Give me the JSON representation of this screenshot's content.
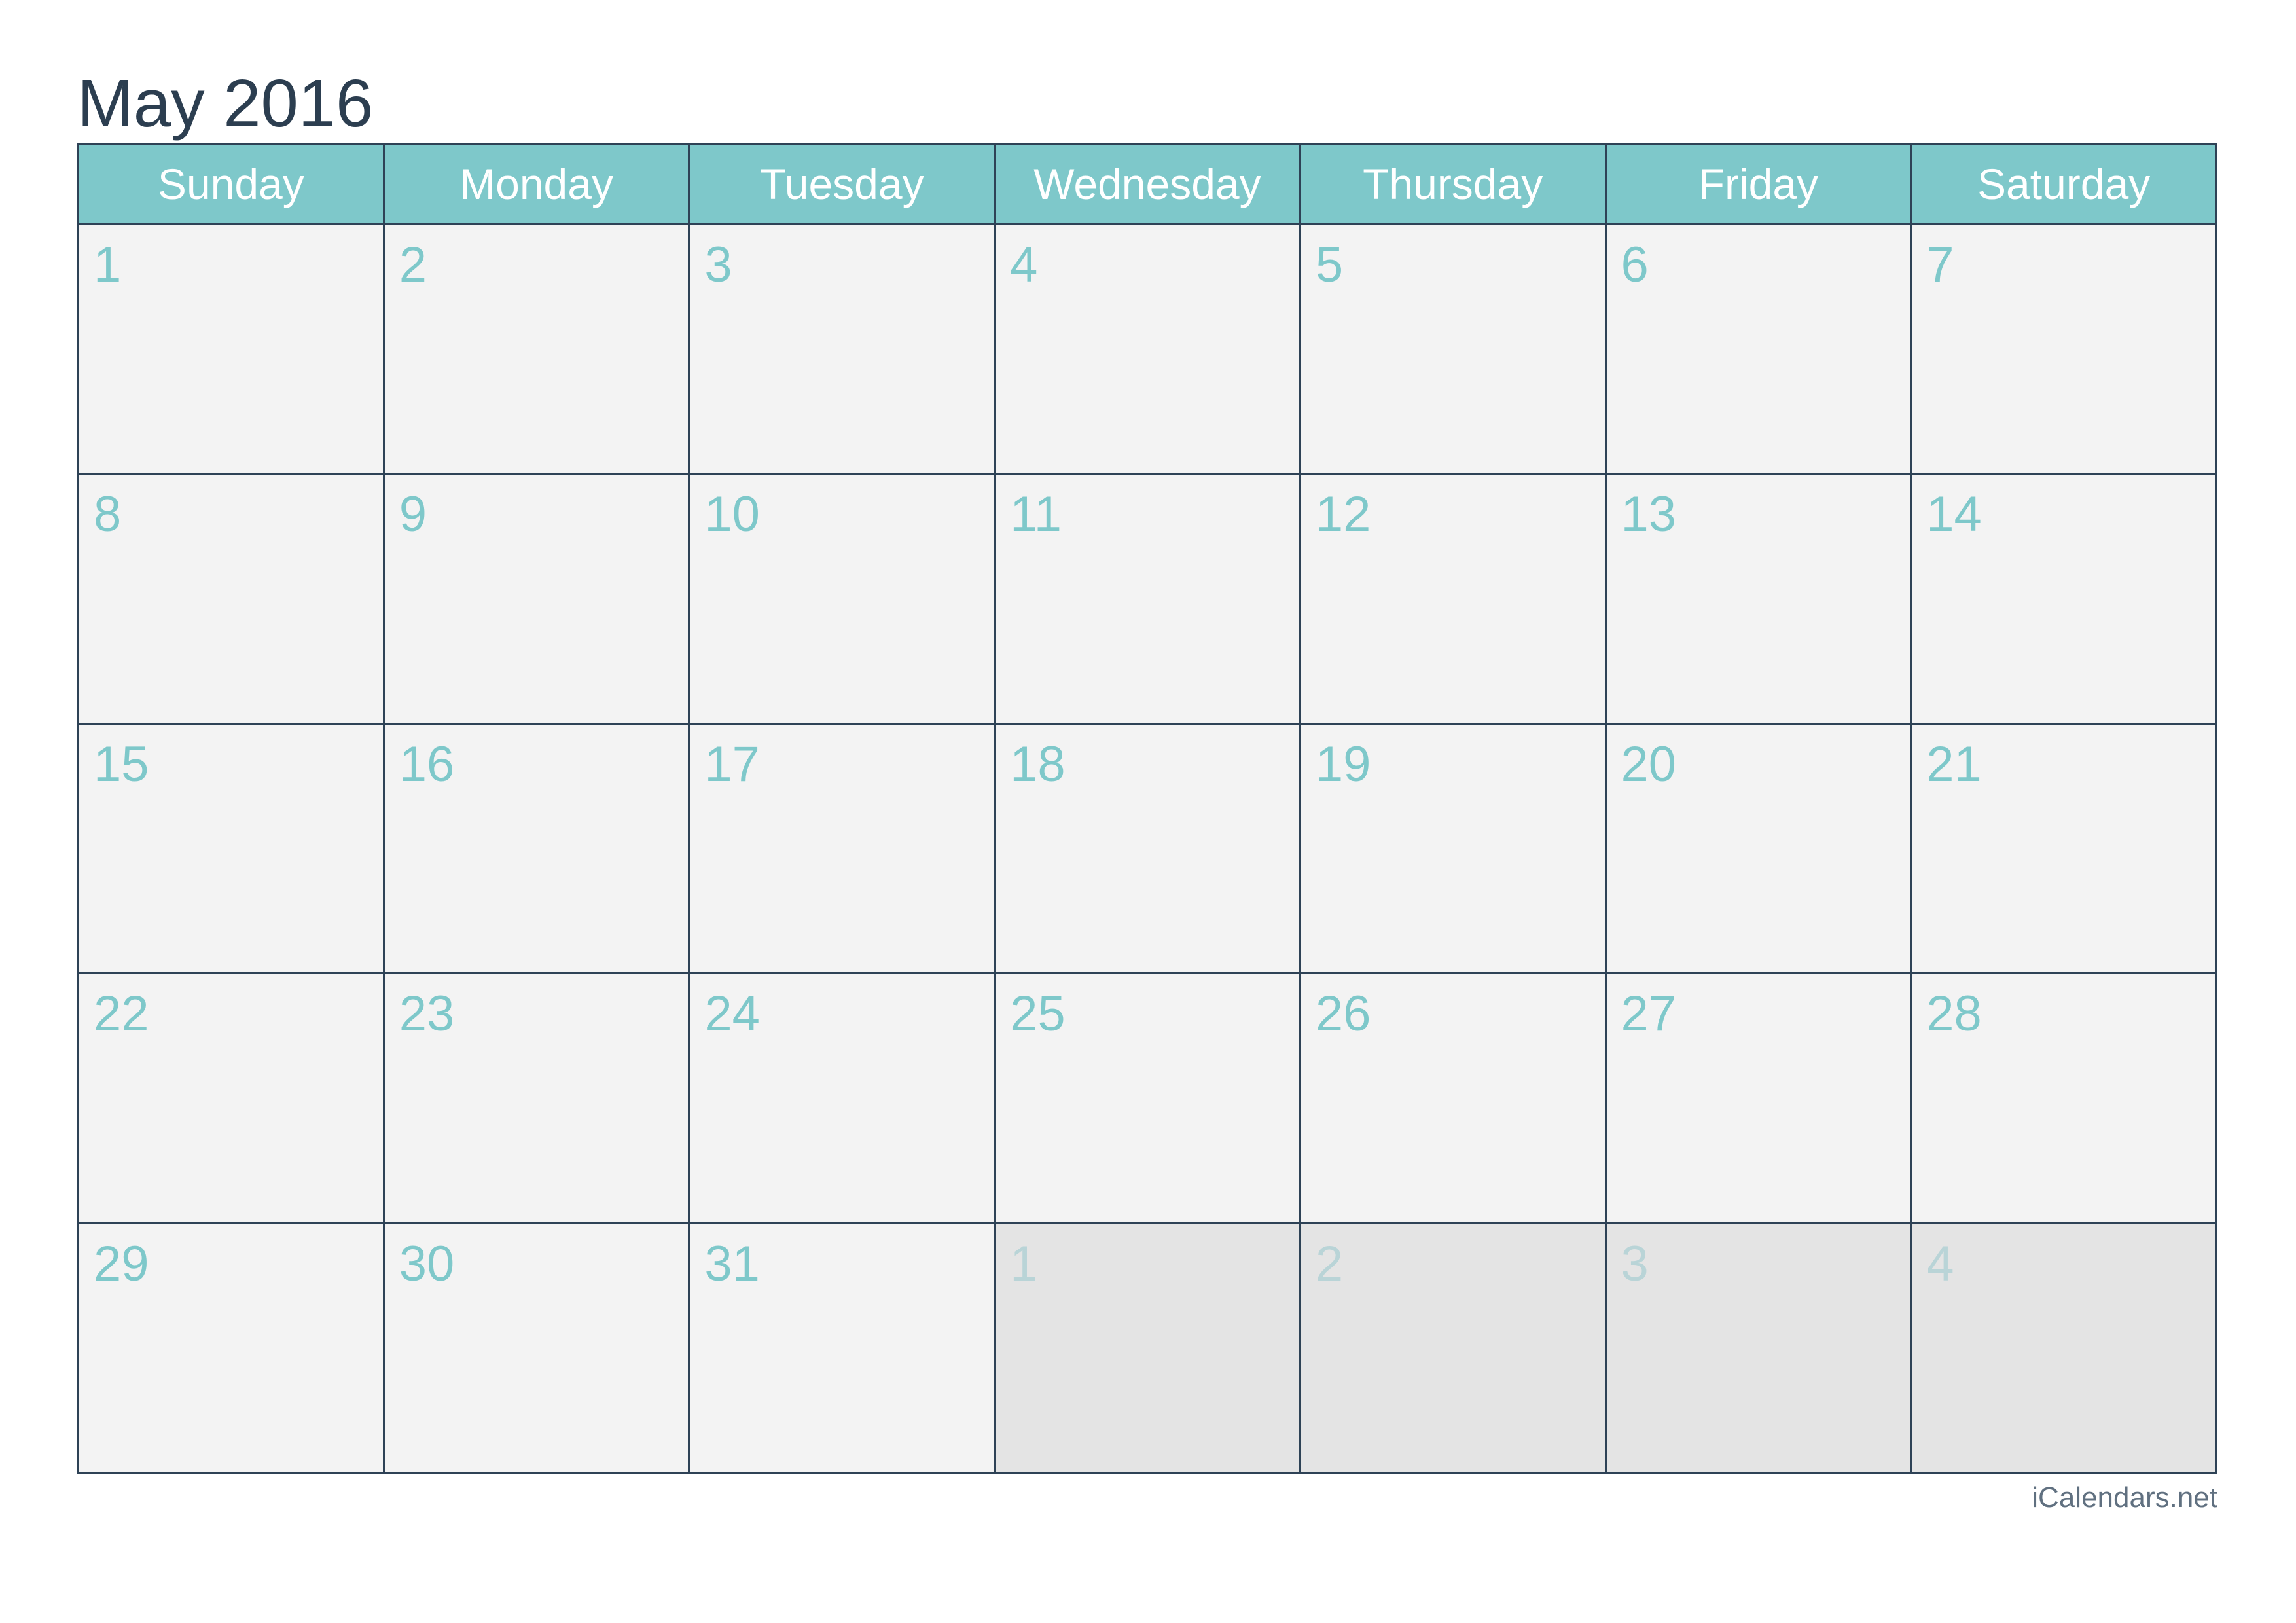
{
  "title": "May 2016",
  "colors": {
    "title": "#2c3e50",
    "header_bg": "#7ec8ca",
    "header_text": "#ffffff",
    "cell_bg": "#f3f3f3",
    "other_month_bg": "#e4e4e4",
    "day_number": "#7ec8ca",
    "other_month_number": "#b9d4d7",
    "grid_line": "#2e4256",
    "footer": "#607080"
  },
  "weekdays": [
    "Sunday",
    "Monday",
    "Tuesday",
    "Wednesday",
    "Thursday",
    "Friday",
    "Saturday"
  ],
  "weeks": [
    [
      {
        "day": "1",
        "current": true
      },
      {
        "day": "2",
        "current": true
      },
      {
        "day": "3",
        "current": true
      },
      {
        "day": "4",
        "current": true
      },
      {
        "day": "5",
        "current": true
      },
      {
        "day": "6",
        "current": true
      },
      {
        "day": "7",
        "current": true
      }
    ],
    [
      {
        "day": "8",
        "current": true
      },
      {
        "day": "9",
        "current": true
      },
      {
        "day": "10",
        "current": true
      },
      {
        "day": "11",
        "current": true
      },
      {
        "day": "12",
        "current": true
      },
      {
        "day": "13",
        "current": true
      },
      {
        "day": "14",
        "current": true
      }
    ],
    [
      {
        "day": "15",
        "current": true
      },
      {
        "day": "16",
        "current": true
      },
      {
        "day": "17",
        "current": true
      },
      {
        "day": "18",
        "current": true
      },
      {
        "day": "19",
        "current": true
      },
      {
        "day": "20",
        "current": true
      },
      {
        "day": "21",
        "current": true
      }
    ],
    [
      {
        "day": "22",
        "current": true
      },
      {
        "day": "23",
        "current": true
      },
      {
        "day": "24",
        "current": true
      },
      {
        "day": "25",
        "current": true
      },
      {
        "day": "26",
        "current": true
      },
      {
        "day": "27",
        "current": true
      },
      {
        "day": "28",
        "current": true
      }
    ],
    [
      {
        "day": "29",
        "current": true
      },
      {
        "day": "30",
        "current": true
      },
      {
        "day": "31",
        "current": true
      },
      {
        "day": "1",
        "current": false
      },
      {
        "day": "2",
        "current": false
      },
      {
        "day": "3",
        "current": false
      },
      {
        "day": "4",
        "current": false
      }
    ]
  ],
  "footer": "iCalendars.net"
}
